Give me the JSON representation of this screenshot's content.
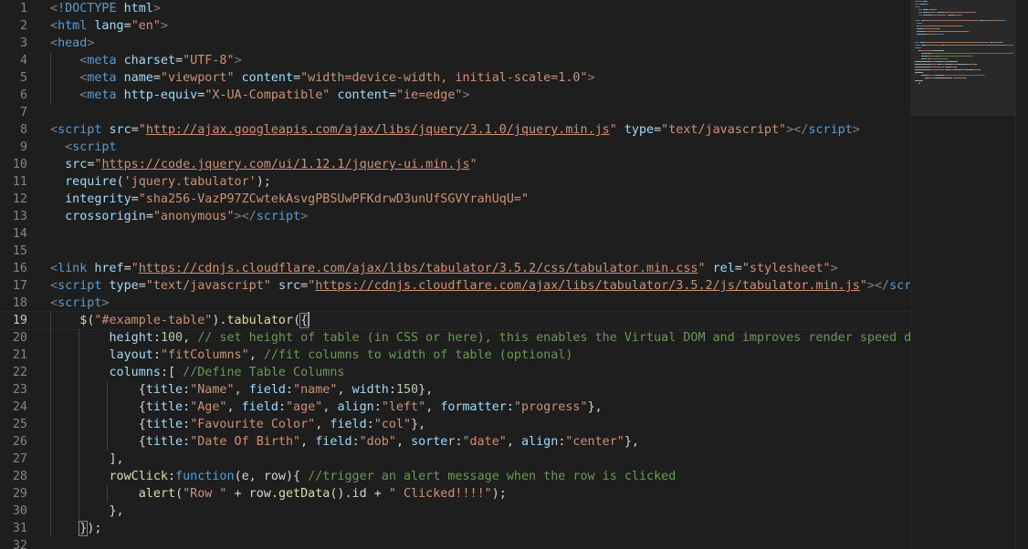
{
  "editor": {
    "current_line": 19,
    "lines": [
      {
        "n": "1",
        "indent": 0,
        "tokens": [
          [
            "t-punct",
            "<"
          ],
          [
            "t-tag",
            "!DOCTYPE"
          ],
          [
            "t-text",
            " "
          ],
          [
            "t-attr",
            "html"
          ],
          [
            "t-punct",
            ">"
          ]
        ]
      },
      {
        "n": "2",
        "indent": 0,
        "tokens": [
          [
            "t-punct",
            "<"
          ],
          [
            "t-tag",
            "html"
          ],
          [
            "t-text",
            " "
          ],
          [
            "t-attr",
            "lang"
          ],
          [
            "t-text",
            "="
          ],
          [
            "t-str",
            "\"en\""
          ],
          [
            "t-punct",
            ">"
          ]
        ]
      },
      {
        "n": "3",
        "indent": 0,
        "tokens": [
          [
            "t-punct",
            "<"
          ],
          [
            "t-tag",
            "head"
          ],
          [
            "t-punct",
            ">"
          ]
        ]
      },
      {
        "n": "4",
        "indent": 1,
        "tokens": [
          [
            "t-text",
            "    "
          ],
          [
            "t-punct",
            "<"
          ],
          [
            "t-tag",
            "meta"
          ],
          [
            "t-text",
            " "
          ],
          [
            "t-attr",
            "charset"
          ],
          [
            "t-text",
            "="
          ],
          [
            "t-str",
            "\"UTF-8\""
          ],
          [
            "t-punct",
            ">"
          ]
        ]
      },
      {
        "n": "5",
        "indent": 1,
        "tokens": [
          [
            "t-text",
            "    "
          ],
          [
            "t-punct",
            "<"
          ],
          [
            "t-tag",
            "meta"
          ],
          [
            "t-text",
            " "
          ],
          [
            "t-attr",
            "name"
          ],
          [
            "t-text",
            "="
          ],
          [
            "t-str",
            "\"viewport\""
          ],
          [
            "t-text",
            " "
          ],
          [
            "t-attr",
            "content"
          ],
          [
            "t-text",
            "="
          ],
          [
            "t-str",
            "\"width=device-width, initial-scale=1.0\""
          ],
          [
            "t-punct",
            ">"
          ]
        ]
      },
      {
        "n": "6",
        "indent": 1,
        "tokens": [
          [
            "t-text",
            "    "
          ],
          [
            "t-punct",
            "<"
          ],
          [
            "t-tag",
            "meta"
          ],
          [
            "t-text",
            " "
          ],
          [
            "t-attr",
            "http-equiv"
          ],
          [
            "t-text",
            "="
          ],
          [
            "t-str",
            "\"X-UA-Compatible\""
          ],
          [
            "t-text",
            " "
          ],
          [
            "t-attr",
            "content"
          ],
          [
            "t-text",
            "="
          ],
          [
            "t-str",
            "\"ie=edge\""
          ],
          [
            "t-punct",
            ">"
          ]
        ]
      },
      {
        "n": "7",
        "indent": 0,
        "tokens": []
      },
      {
        "n": "8",
        "indent": 0,
        "tokens": [
          [
            "t-punct",
            "<"
          ],
          [
            "t-tag",
            "script"
          ],
          [
            "t-text",
            " "
          ],
          [
            "t-attr",
            "src"
          ],
          [
            "t-text",
            "="
          ],
          [
            "t-str",
            "\""
          ],
          [
            "t-link",
            "http://ajax.googleapis.com/ajax/libs/jquery/3.1.0/jquery.min.js"
          ],
          [
            "t-str",
            "\""
          ],
          [
            "t-text",
            " "
          ],
          [
            "t-attr",
            "type"
          ],
          [
            "t-text",
            "="
          ],
          [
            "t-str",
            "\"text/javascript\""
          ],
          [
            "t-punct",
            "></"
          ],
          [
            "t-tag",
            "script"
          ],
          [
            "t-punct",
            ">"
          ]
        ]
      },
      {
        "n": "9",
        "indent": 0,
        "tokens": [
          [
            "t-text",
            "  "
          ],
          [
            "t-punct",
            "<"
          ],
          [
            "t-tag",
            "script"
          ]
        ]
      },
      {
        "n": "10",
        "indent": 0,
        "tokens": [
          [
            "t-text",
            "  "
          ],
          [
            "t-attr",
            "src"
          ],
          [
            "t-text",
            "="
          ],
          [
            "t-str",
            "\""
          ],
          [
            "t-link",
            "https://code.jquery.com/ui/1.12.1/jquery-ui.min.js"
          ],
          [
            "t-str",
            "\""
          ]
        ]
      },
      {
        "n": "11",
        "indent": 0,
        "tokens": [
          [
            "t-text",
            "  "
          ],
          [
            "t-attr",
            "require"
          ],
          [
            "t-text",
            "("
          ],
          [
            "t-str",
            "'jquery.tabulator'"
          ],
          [
            "t-text",
            ");"
          ]
        ]
      },
      {
        "n": "12",
        "indent": 0,
        "tokens": [
          [
            "t-text",
            "  "
          ],
          [
            "t-attr",
            "integrity"
          ],
          [
            "t-text",
            "="
          ],
          [
            "t-str",
            "\"sha256-VazP97ZCwtekAsvgPBSUwPFKdrwD3unUfSGVYrahUqU=\""
          ]
        ]
      },
      {
        "n": "13",
        "indent": 0,
        "tokens": [
          [
            "t-text",
            "  "
          ],
          [
            "t-attr",
            "crossorigin"
          ],
          [
            "t-text",
            "="
          ],
          [
            "t-str",
            "\"anonymous\""
          ],
          [
            "t-punct",
            "></"
          ],
          [
            "t-tag",
            "script"
          ],
          [
            "t-punct",
            ">"
          ]
        ]
      },
      {
        "n": "14",
        "indent": 0,
        "tokens": []
      },
      {
        "n": "15",
        "indent": 0,
        "tokens": []
      },
      {
        "n": "16",
        "indent": 0,
        "tokens": [
          [
            "t-punct",
            "<"
          ],
          [
            "t-tag",
            "link"
          ],
          [
            "t-text",
            " "
          ],
          [
            "t-attr",
            "href"
          ],
          [
            "t-text",
            "="
          ],
          [
            "t-str",
            "\""
          ],
          [
            "t-link",
            "https://cdnjs.cloudflare.com/ajax/libs/tabulator/3.5.2/css/tabulator.min.css"
          ],
          [
            "t-str",
            "\""
          ],
          [
            "t-text",
            " "
          ],
          [
            "t-attr",
            "rel"
          ],
          [
            "t-text",
            "="
          ],
          [
            "t-str",
            "\"stylesheet\""
          ],
          [
            "t-punct",
            ">"
          ]
        ]
      },
      {
        "n": "17",
        "indent": 0,
        "tokens": [
          [
            "t-punct",
            "<"
          ],
          [
            "t-tag",
            "script"
          ],
          [
            "t-text",
            " "
          ],
          [
            "t-attr",
            "type"
          ],
          [
            "t-text",
            "="
          ],
          [
            "t-str",
            "\"text/javascript\""
          ],
          [
            "t-text",
            " "
          ],
          [
            "t-attr",
            "src"
          ],
          [
            "t-text",
            "="
          ],
          [
            "t-str",
            "\""
          ],
          [
            "t-link",
            "https://cdnjs.cloudflare.com/ajax/libs/tabulator/3.5.2/js/tabulator.min.js"
          ],
          [
            "t-str",
            "\""
          ],
          [
            "t-punct",
            "></"
          ],
          [
            "t-tag",
            "script"
          ],
          [
            "t-punct",
            ">"
          ]
        ]
      },
      {
        "n": "18",
        "indent": 0,
        "tokens": [
          [
            "t-punct",
            "<"
          ],
          [
            "t-tag",
            "script"
          ],
          [
            "t-punct",
            ">"
          ]
        ]
      },
      {
        "n": "19",
        "indent": 1,
        "tokens": [
          [
            "t-text",
            "    "
          ],
          [
            "t-fn",
            "$"
          ],
          [
            "t-text",
            "("
          ],
          [
            "t-str",
            "\"#example-table\""
          ],
          [
            "t-text",
            ")."
          ],
          [
            "t-fn",
            "tabulator"
          ],
          [
            "t-text",
            "("
          ],
          [
            "t-bracket",
            "{"
          ],
          [
            "cursor",
            ""
          ]
        ]
      },
      {
        "n": "20",
        "indent": 2,
        "tokens": [
          [
            "t-text",
            "        "
          ],
          [
            "t-attr",
            "height"
          ],
          [
            "t-text",
            ":"
          ],
          [
            "t-num",
            "100"
          ],
          [
            "t-text",
            ", "
          ],
          [
            "t-com",
            "// set height of table (in CSS or here), this enables the Virtual DOM and improves render speed dramatically"
          ]
        ]
      },
      {
        "n": "21",
        "indent": 2,
        "tokens": [
          [
            "t-text",
            "        "
          ],
          [
            "t-attr",
            "layout"
          ],
          [
            "t-text",
            ":"
          ],
          [
            "t-str",
            "\"fitColumns\""
          ],
          [
            "t-text",
            ", "
          ],
          [
            "t-com",
            "//fit columns to width of table (optional)"
          ]
        ]
      },
      {
        "n": "22",
        "indent": 2,
        "tokens": [
          [
            "t-text",
            "        "
          ],
          [
            "t-attr",
            "columns"
          ],
          [
            "t-text",
            ":[ "
          ],
          [
            "t-com",
            "//Define Table Columns"
          ]
        ]
      },
      {
        "n": "23",
        "indent": 3,
        "tokens": [
          [
            "t-text",
            "            {"
          ],
          [
            "t-attr",
            "title"
          ],
          [
            "t-text",
            ":"
          ],
          [
            "t-str",
            "\"Name\""
          ],
          [
            "t-text",
            ", "
          ],
          [
            "t-attr",
            "field"
          ],
          [
            "t-text",
            ":"
          ],
          [
            "t-str",
            "\"name\""
          ],
          [
            "t-text",
            ", "
          ],
          [
            "t-attr",
            "width"
          ],
          [
            "t-text",
            ":"
          ],
          [
            "t-num",
            "150"
          ],
          [
            "t-text",
            "},"
          ]
        ]
      },
      {
        "n": "24",
        "indent": 3,
        "tokens": [
          [
            "t-text",
            "            {"
          ],
          [
            "t-attr",
            "title"
          ],
          [
            "t-text",
            ":"
          ],
          [
            "t-str",
            "\"Age\""
          ],
          [
            "t-text",
            ", "
          ],
          [
            "t-attr",
            "field"
          ],
          [
            "t-text",
            ":"
          ],
          [
            "t-str",
            "\"age\""
          ],
          [
            "t-text",
            ", "
          ],
          [
            "t-attr",
            "align"
          ],
          [
            "t-text",
            ":"
          ],
          [
            "t-str",
            "\"left\""
          ],
          [
            "t-text",
            ", "
          ],
          [
            "t-attr",
            "formatter"
          ],
          [
            "t-text",
            ":"
          ],
          [
            "t-str",
            "\"progress\""
          ],
          [
            "t-text",
            "},"
          ]
        ]
      },
      {
        "n": "25",
        "indent": 3,
        "tokens": [
          [
            "t-text",
            "            {"
          ],
          [
            "t-attr",
            "title"
          ],
          [
            "t-text",
            ":"
          ],
          [
            "t-str",
            "\"Favourite Color\""
          ],
          [
            "t-text",
            ", "
          ],
          [
            "t-attr",
            "field"
          ],
          [
            "t-text",
            ":"
          ],
          [
            "t-str",
            "\"col\""
          ],
          [
            "t-text",
            "},"
          ]
        ]
      },
      {
        "n": "26",
        "indent": 3,
        "tokens": [
          [
            "t-text",
            "            {"
          ],
          [
            "t-attr",
            "title"
          ],
          [
            "t-text",
            ":"
          ],
          [
            "t-str",
            "\"Date Of Birth\""
          ],
          [
            "t-text",
            ", "
          ],
          [
            "t-attr",
            "field"
          ],
          [
            "t-text",
            ":"
          ],
          [
            "t-str",
            "\"dob\""
          ],
          [
            "t-text",
            ", "
          ],
          [
            "t-attr",
            "sorter"
          ],
          [
            "t-text",
            ":"
          ],
          [
            "t-str",
            "\"date\""
          ],
          [
            "t-text",
            ", "
          ],
          [
            "t-attr",
            "align"
          ],
          [
            "t-text",
            ":"
          ],
          [
            "t-str",
            "\"center\""
          ],
          [
            "t-text",
            "},"
          ]
        ]
      },
      {
        "n": "27",
        "indent": 2,
        "tokens": [
          [
            "t-text",
            "        ],"
          ]
        ]
      },
      {
        "n": "28",
        "indent": 2,
        "tokens": [
          [
            "t-text",
            "        "
          ],
          [
            "t-fn",
            "rowClick"
          ],
          [
            "t-text",
            ":"
          ],
          [
            "t-kw",
            "function"
          ],
          [
            "t-text",
            "(e, row){ "
          ],
          [
            "t-com",
            "//trigger an alert message when the row is clicked"
          ]
        ]
      },
      {
        "n": "29",
        "indent": 3,
        "tokens": [
          [
            "t-text",
            "            "
          ],
          [
            "t-fn",
            "alert"
          ],
          [
            "t-text",
            "("
          ],
          [
            "t-str",
            "\"Row \""
          ],
          [
            "t-text",
            " + row."
          ],
          [
            "t-fn",
            "getData"
          ],
          [
            "t-text",
            "().id + "
          ],
          [
            "t-str",
            "\" Clicked!!!!\""
          ],
          [
            "t-text",
            ");"
          ]
        ]
      },
      {
        "n": "30",
        "indent": 2,
        "tokens": [
          [
            "t-text",
            "        },"
          ]
        ]
      },
      {
        "n": "31",
        "indent": 1,
        "tokens": [
          [
            "t-text",
            "    "
          ],
          [
            "t-bracket",
            "}"
          ],
          [
            "t-text",
            ");"
          ]
        ]
      },
      {
        "n": "32",
        "indent": 0,
        "tokens": []
      }
    ]
  },
  "colors": {
    "background": "#1e1e1e",
    "line_number": "#858585",
    "tag": "#569cd6",
    "attribute": "#9cdcfe",
    "string": "#ce9178",
    "comment": "#6a9955",
    "function": "#dcdcaa",
    "number": "#b5cea8"
  }
}
